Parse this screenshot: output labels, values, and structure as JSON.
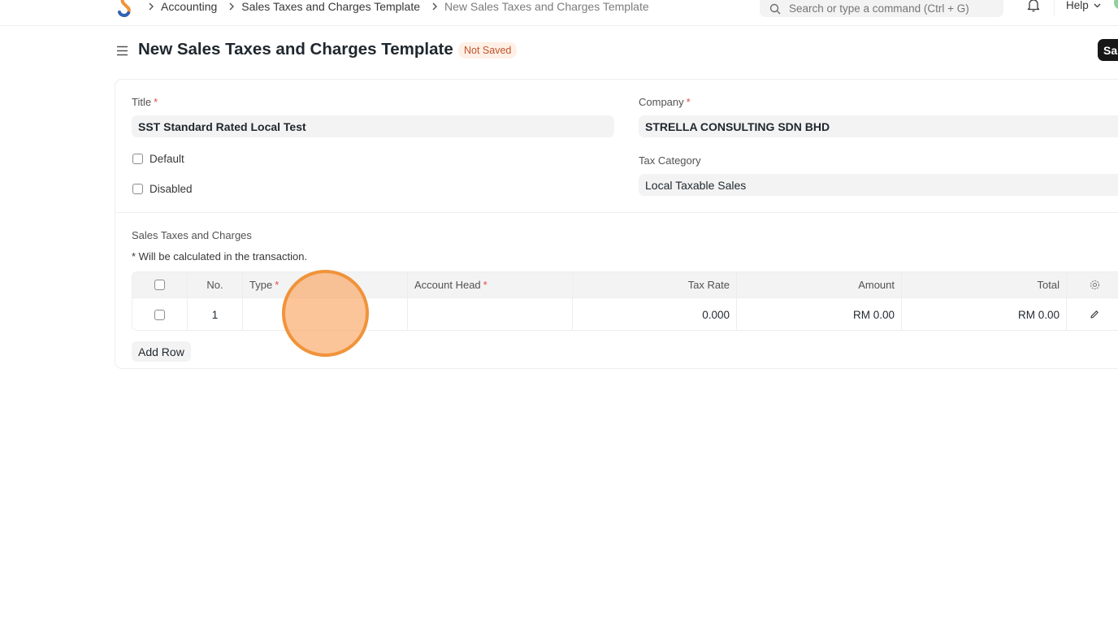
{
  "breadcrumbs": [
    "Accounting",
    "Sales Taxes and Charges Template",
    "New Sales Taxes and Charges Template"
  ],
  "search": {
    "placeholder": "Search or type a command (Ctrl + G)"
  },
  "help_label": "Help",
  "page": {
    "title": "New Sales Taxes and Charges Template",
    "status": "Not Saved",
    "save_label": "Sa"
  },
  "form": {
    "title_label": "Title",
    "title_value": "SST Standard Rated Local Test",
    "default_label": "Default",
    "disabled_label": "Disabled",
    "company_label": "Company",
    "company_value": "STRELLA CONSULTING SDN BHD",
    "tax_category_label": "Tax Category",
    "tax_category_value": "Local Taxable Sales",
    "required_mark": "*"
  },
  "taxes_section": {
    "label": "Sales Taxes and Charges",
    "note": "* Will be calculated in the transaction.",
    "columns": {
      "no": "No.",
      "type": "Type",
      "account_head": "Account Head",
      "tax_rate": "Tax Rate",
      "amount": "Amount",
      "total": "Total"
    },
    "rows": [
      {
        "no": "1",
        "type": "",
        "account_head": "",
        "tax_rate": "0.000",
        "amount": "RM 0.00",
        "total": "RM 0.00"
      }
    ],
    "add_row_label": "Add Row"
  },
  "colors": {
    "accent": "#171717",
    "status_badge_bg": "#fff0e6",
    "status_badge_text": "#c0532d",
    "required": "#e24c4c",
    "click_indicator": "#f0933a"
  },
  "icons": [
    "app-logo-icon",
    "chevron-right-icon",
    "search-icon",
    "bell-icon",
    "chevron-down-icon",
    "hamburger-menu-icon",
    "gear-icon",
    "pencil-icon"
  ]
}
